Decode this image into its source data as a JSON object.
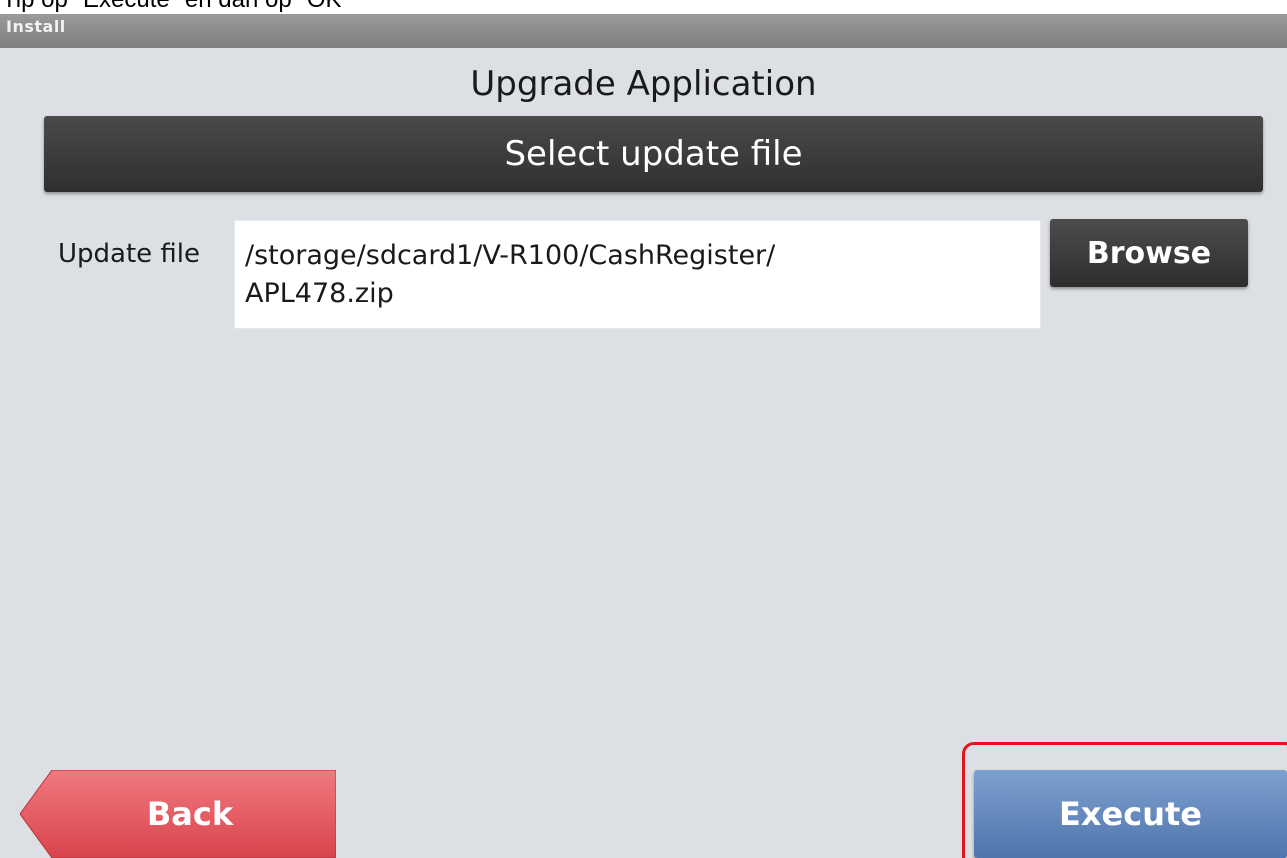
{
  "caption": "Tip op \"Execute\" en dan op \"OK\"",
  "statusbar": {
    "title": "Install"
  },
  "page": {
    "title": "Upgrade Application",
    "section_title": "Select update file"
  },
  "update_file": {
    "label": "Update file",
    "value_line1": "/storage/sdcard1/V-R100/CashRegister/",
    "value_line2": "APL478.zip",
    "browse_label": "Browse"
  },
  "footer": {
    "back_label": "Back",
    "execute_label": "Execute"
  },
  "colors": {
    "background": "#dcdfe3",
    "section_bar": "#3a3a3a",
    "back_button": "#e35a62",
    "execute_button": "#6388c0",
    "highlight": "#e2141e"
  }
}
